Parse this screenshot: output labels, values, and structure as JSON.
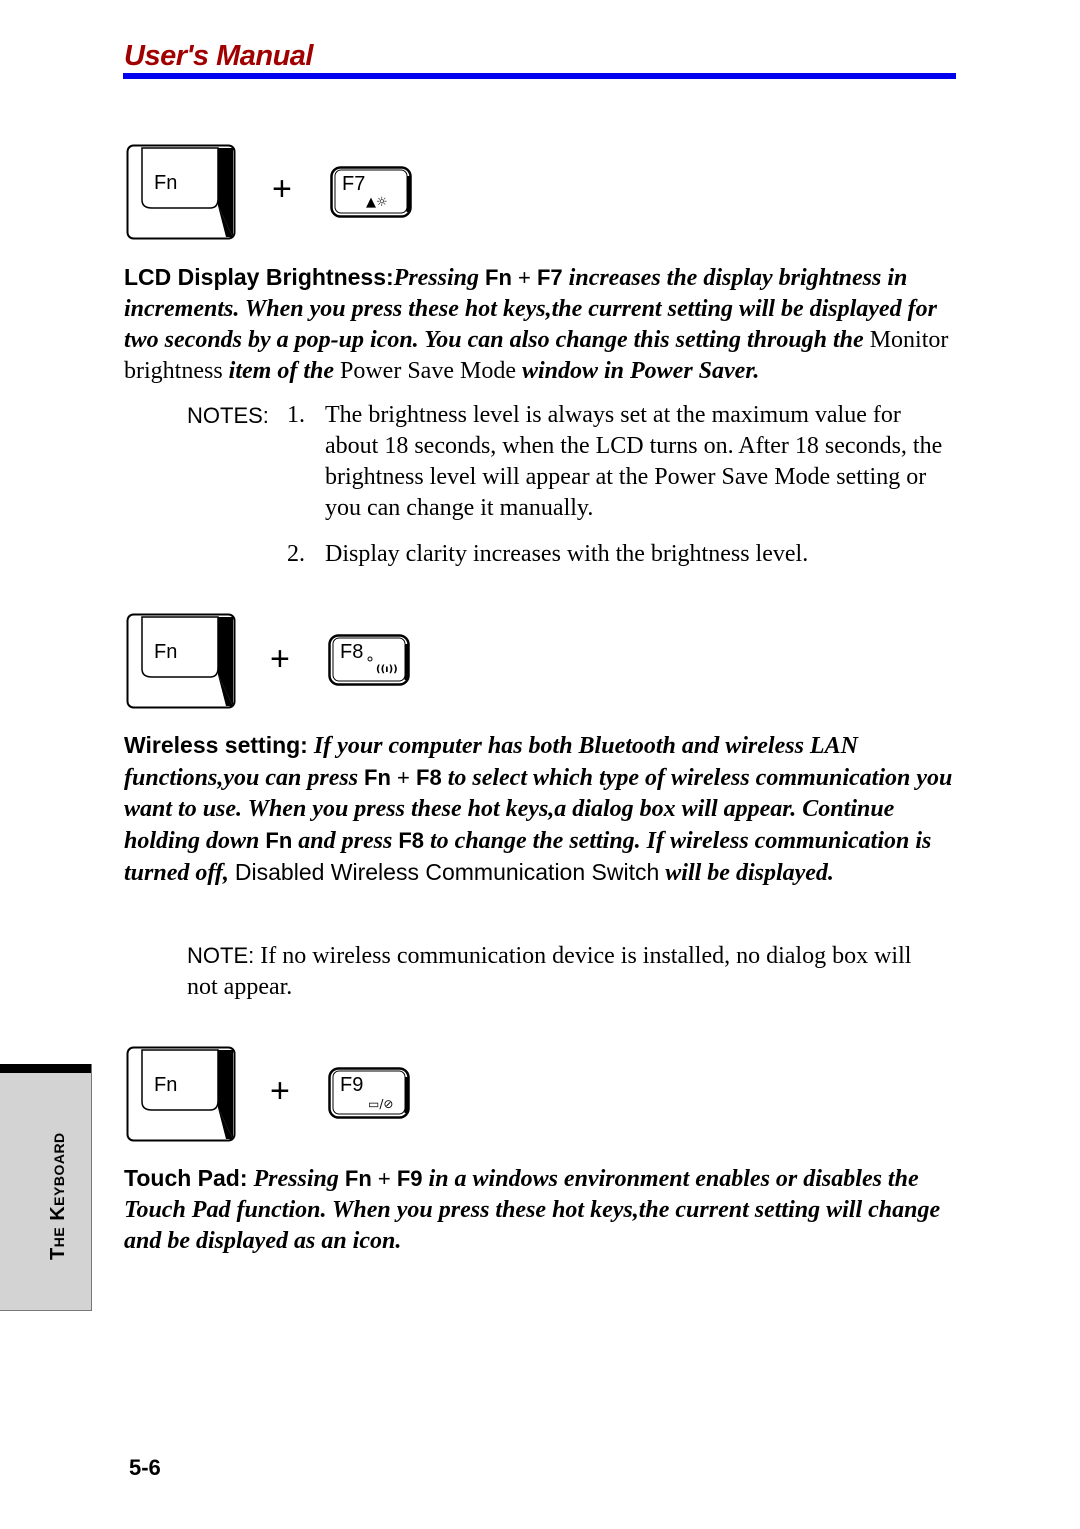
{
  "header": {
    "title": "User's Manual",
    "rule_color": "#0000ee",
    "title_color": "#a00000"
  },
  "sections": [
    {
      "keys": {
        "fn_label": "Fn",
        "plus": "+",
        "fkey_label": "F7",
        "fkey_icon": "brightness-up-icon",
        "fkey_glyph": "▲☼"
      },
      "lead": "LCD Display Brightness:",
      "text": {
        "p1": "Pressing",
        "k1": "Fn",
        "plus": " + ",
        "k2": "F7",
        "p2": " increases the display brightness in increments. When you press these hot keys,the current setting will be displayed for two seconds by a pop-up icon. You can also change this setting through the ",
        "r1": "Monitor brightness",
        "p3": " item of the ",
        "r2": "Power Save Mode",
        "p4": " window in Power Saver."
      },
      "notes": {
        "label": "NOTES:",
        "items": [
          {
            "num": "1.",
            "text": "The brightness level is always set at the maximum value for about 18 seconds, when the LCD turns on. After 18 seconds, the brightness level will appear at the Power Save Mode setting or you can change it manually."
          },
          {
            "num": "2.",
            "text": "Display clarity increases with the brightness level."
          }
        ]
      }
    },
    {
      "keys": {
        "fn_label": "Fn",
        "plus": "+",
        "fkey_label": "F8",
        "fkey_icon": "wireless-antenna-icon",
        "fkey_glyph": "((ı))"
      },
      "lead": "Wireless setting:",
      "text": {
        "p1": " If your computer has both Bluetooth and wireless LAN functions,you can press ",
        "k1": "Fn",
        "plus": " + ",
        "k2": "F8",
        "p2": " to select which type of wireless communication you want to use. When you press these hot keys,a dialog box will appear. Continue holding down ",
        "k3": "Fn",
        "p3": " and press ",
        "k4": "F8",
        "p4": " to change the setting. If wireless communication is turned off, ",
        "s1": "Disabled Wireless Communication Switch",
        "p5": "  will be displayed."
      },
      "note": {
        "label": "NOTE:",
        "text": " If no wireless communication device is installed, no dialog box will not appear."
      }
    },
    {
      "keys": {
        "fn_label": "Fn",
        "plus": "+",
        "fkey_label": "F9",
        "fkey_icon": "touchpad-toggle-icon",
        "fkey_glyph": "▭/⊘"
      },
      "lead": "Touch Pad:",
      "text": {
        "p1": " Pressing ",
        "k1": "Fn",
        "plus": " + ",
        "k2": "F9",
        "p2": " in a windows environment enables or disables the Touch Pad function. When you press these hot keys,the current setting will change and be displayed as an icon."
      }
    }
  ],
  "side_tab": {
    "label": "The Keyboard"
  },
  "footer": {
    "page_number": "5-6"
  }
}
